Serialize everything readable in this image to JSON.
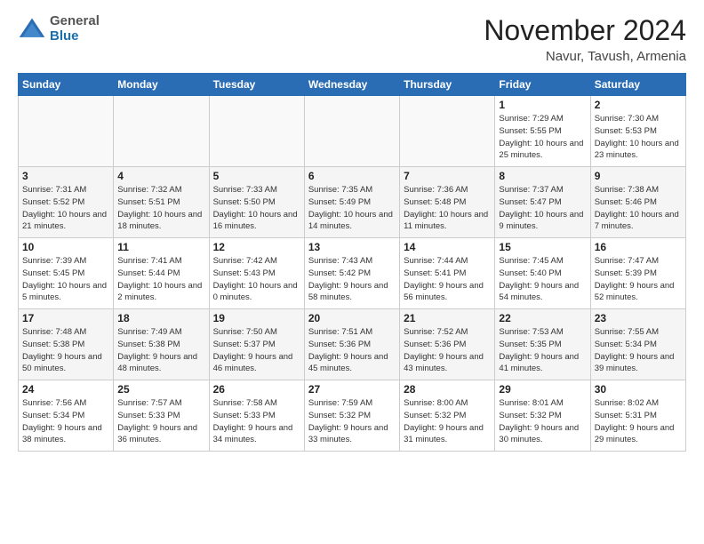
{
  "logo": {
    "general": "General",
    "blue": "Blue"
  },
  "header": {
    "month": "November 2024",
    "location": "Navur, Tavush, Armenia"
  },
  "weekdays": [
    "Sunday",
    "Monday",
    "Tuesday",
    "Wednesday",
    "Thursday",
    "Friday",
    "Saturday"
  ],
  "weeks": [
    [
      {
        "day": "",
        "info": ""
      },
      {
        "day": "",
        "info": ""
      },
      {
        "day": "",
        "info": ""
      },
      {
        "day": "",
        "info": ""
      },
      {
        "day": "",
        "info": ""
      },
      {
        "day": "1",
        "info": "Sunrise: 7:29 AM\nSunset: 5:55 PM\nDaylight: 10 hours and 25 minutes."
      },
      {
        "day": "2",
        "info": "Sunrise: 7:30 AM\nSunset: 5:53 PM\nDaylight: 10 hours and 23 minutes."
      }
    ],
    [
      {
        "day": "3",
        "info": "Sunrise: 7:31 AM\nSunset: 5:52 PM\nDaylight: 10 hours and 21 minutes."
      },
      {
        "day": "4",
        "info": "Sunrise: 7:32 AM\nSunset: 5:51 PM\nDaylight: 10 hours and 18 minutes."
      },
      {
        "day": "5",
        "info": "Sunrise: 7:33 AM\nSunset: 5:50 PM\nDaylight: 10 hours and 16 minutes."
      },
      {
        "day": "6",
        "info": "Sunrise: 7:35 AM\nSunset: 5:49 PM\nDaylight: 10 hours and 14 minutes."
      },
      {
        "day": "7",
        "info": "Sunrise: 7:36 AM\nSunset: 5:48 PM\nDaylight: 10 hours and 11 minutes."
      },
      {
        "day": "8",
        "info": "Sunrise: 7:37 AM\nSunset: 5:47 PM\nDaylight: 10 hours and 9 minutes."
      },
      {
        "day": "9",
        "info": "Sunrise: 7:38 AM\nSunset: 5:46 PM\nDaylight: 10 hours and 7 minutes."
      }
    ],
    [
      {
        "day": "10",
        "info": "Sunrise: 7:39 AM\nSunset: 5:45 PM\nDaylight: 10 hours and 5 minutes."
      },
      {
        "day": "11",
        "info": "Sunrise: 7:41 AM\nSunset: 5:44 PM\nDaylight: 10 hours and 2 minutes."
      },
      {
        "day": "12",
        "info": "Sunrise: 7:42 AM\nSunset: 5:43 PM\nDaylight: 10 hours and 0 minutes."
      },
      {
        "day": "13",
        "info": "Sunrise: 7:43 AM\nSunset: 5:42 PM\nDaylight: 9 hours and 58 minutes."
      },
      {
        "day": "14",
        "info": "Sunrise: 7:44 AM\nSunset: 5:41 PM\nDaylight: 9 hours and 56 minutes."
      },
      {
        "day": "15",
        "info": "Sunrise: 7:45 AM\nSunset: 5:40 PM\nDaylight: 9 hours and 54 minutes."
      },
      {
        "day": "16",
        "info": "Sunrise: 7:47 AM\nSunset: 5:39 PM\nDaylight: 9 hours and 52 minutes."
      }
    ],
    [
      {
        "day": "17",
        "info": "Sunrise: 7:48 AM\nSunset: 5:38 PM\nDaylight: 9 hours and 50 minutes."
      },
      {
        "day": "18",
        "info": "Sunrise: 7:49 AM\nSunset: 5:38 PM\nDaylight: 9 hours and 48 minutes."
      },
      {
        "day": "19",
        "info": "Sunrise: 7:50 AM\nSunset: 5:37 PM\nDaylight: 9 hours and 46 minutes."
      },
      {
        "day": "20",
        "info": "Sunrise: 7:51 AM\nSunset: 5:36 PM\nDaylight: 9 hours and 45 minutes."
      },
      {
        "day": "21",
        "info": "Sunrise: 7:52 AM\nSunset: 5:36 PM\nDaylight: 9 hours and 43 minutes."
      },
      {
        "day": "22",
        "info": "Sunrise: 7:53 AM\nSunset: 5:35 PM\nDaylight: 9 hours and 41 minutes."
      },
      {
        "day": "23",
        "info": "Sunrise: 7:55 AM\nSunset: 5:34 PM\nDaylight: 9 hours and 39 minutes."
      }
    ],
    [
      {
        "day": "24",
        "info": "Sunrise: 7:56 AM\nSunset: 5:34 PM\nDaylight: 9 hours and 38 minutes."
      },
      {
        "day": "25",
        "info": "Sunrise: 7:57 AM\nSunset: 5:33 PM\nDaylight: 9 hours and 36 minutes."
      },
      {
        "day": "26",
        "info": "Sunrise: 7:58 AM\nSunset: 5:33 PM\nDaylight: 9 hours and 34 minutes."
      },
      {
        "day": "27",
        "info": "Sunrise: 7:59 AM\nSunset: 5:32 PM\nDaylight: 9 hours and 33 minutes."
      },
      {
        "day": "28",
        "info": "Sunrise: 8:00 AM\nSunset: 5:32 PM\nDaylight: 9 hours and 31 minutes."
      },
      {
        "day": "29",
        "info": "Sunrise: 8:01 AM\nSunset: 5:32 PM\nDaylight: 9 hours and 30 minutes."
      },
      {
        "day": "30",
        "info": "Sunrise: 8:02 AM\nSunset: 5:31 PM\nDaylight: 9 hours and 29 minutes."
      }
    ]
  ]
}
